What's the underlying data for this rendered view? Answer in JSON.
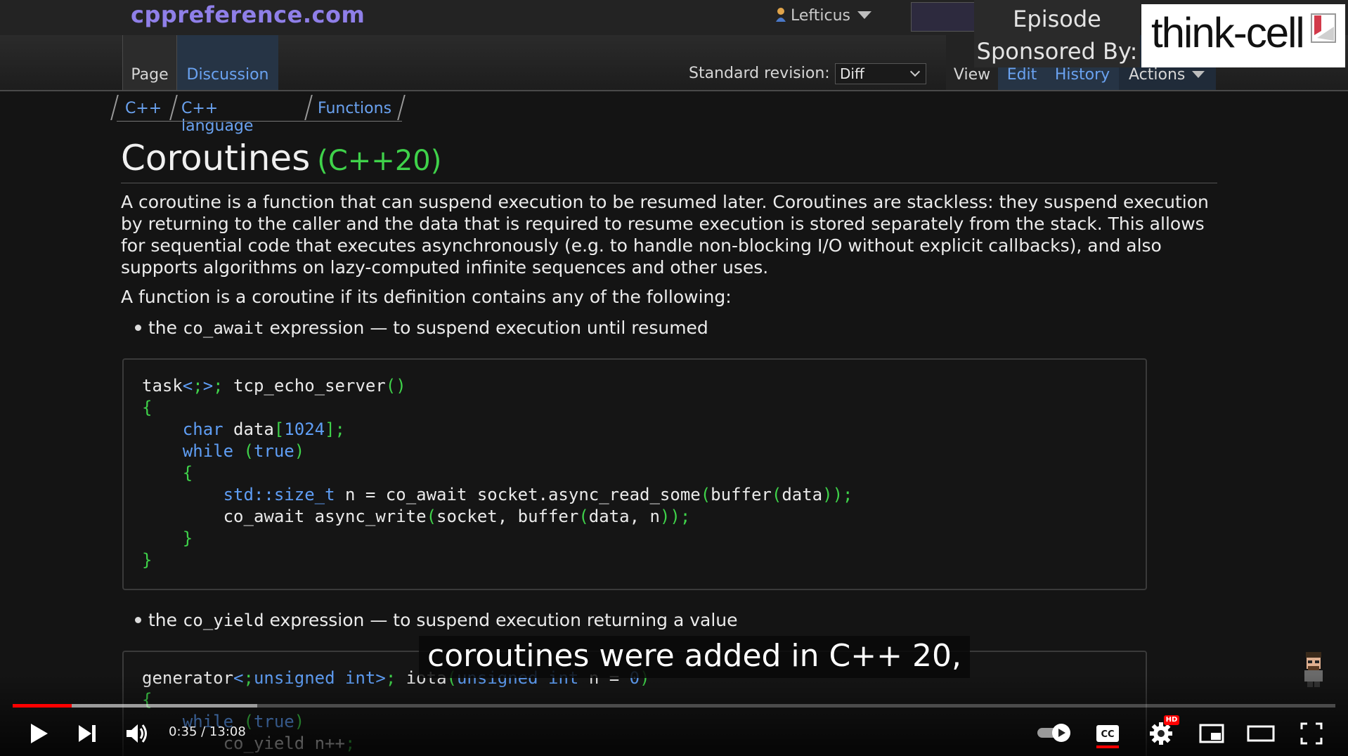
{
  "site": {
    "logo": "cppreference.com",
    "user_name": "Lefticus"
  },
  "tabs": {
    "page": "Page",
    "discussion": "Discussion",
    "view": "View",
    "edit": "Edit",
    "history": "History",
    "actions": "Actions"
  },
  "standard_revision": {
    "label": "Standard revision:",
    "value": "Diff"
  },
  "breadcrumb": [
    "C++",
    "C++ language",
    "Functions"
  ],
  "article": {
    "title": "Coroutines",
    "title_rev": "(C++20)",
    "para1": "A coroutine is a function that can suspend execution to be resumed later. Coroutines are stackless: they suspend execution by returning to the caller and the data that is required to resume execution is stored separately from the stack. This allows for sequential code that executes asynchronously (e.g. to handle non-blocking I/O without explicit callbacks), and also supports algorithms on lazy-computed infinite sequences and other uses.",
    "para2": "A function is a coroutine if its definition contains any of the following:",
    "bullet1_pre": "the ",
    "bullet1_code": "co_await",
    "bullet1_post": " expression — to suspend execution until resumed",
    "bullet2_pre": "the ",
    "bullet2_code": "co_yield",
    "bullet2_post": " expression — to suspend execution returning a value"
  },
  "code1": [
    "task<> tcp_echo_server()",
    "{",
    "    char data[1024];",
    "    while (true)",
    "    {",
    "        std::size_t n = co_await socket.async_read_some(buffer(data));",
    "        co_await async_write(socket, buffer(data, n));",
    "    }",
    "}"
  ],
  "code2": [
    "generator<unsigned int> iota(unsigned int n = 0)",
    "{",
    "    while (true)",
    "        co_yield n++;"
  ],
  "sponsor": {
    "line1": "Episode",
    "line2": "Sponsored By:",
    "brand": "think-cell"
  },
  "caption": "coroutines were added in C++ 20,",
  "player": {
    "time": "0:35 / 13:08",
    "played_fraction": 0.0446,
    "buffered_fraction": 0.185,
    "hd_badge": "HD",
    "icons": [
      "play-icon",
      "next-icon",
      "volume-icon",
      "autoplay-toggle-icon",
      "subtitles-icon",
      "settings-icon",
      "miniplayer-icon",
      "theater-mode-icon",
      "fullscreen-icon"
    ]
  },
  "colors": {
    "accent_link": "#6aa2f0",
    "cpp_rev_green": "#3fd24a",
    "logo_purple": "#8f7fe8",
    "progress_red": "#ff0000"
  }
}
